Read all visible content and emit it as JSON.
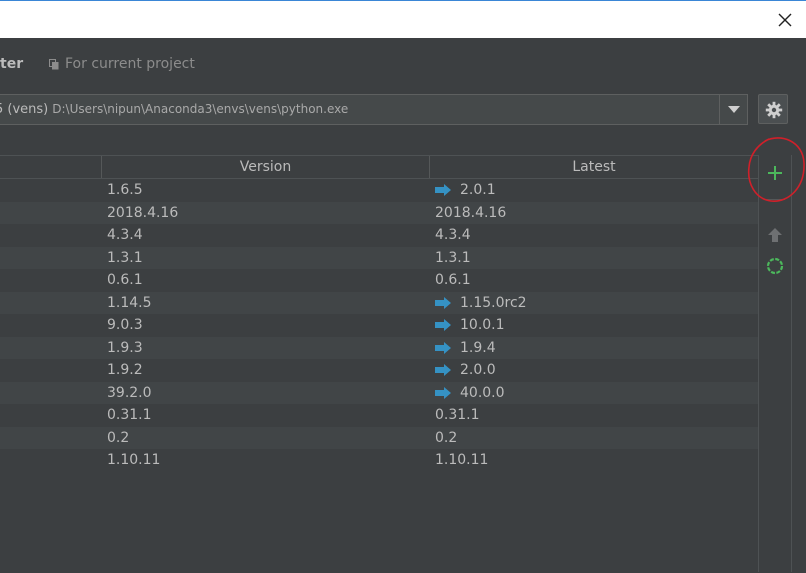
{
  "window": {
    "close_icon": "close-icon"
  },
  "breadcrumb": {
    "interpreter_partial": "ter",
    "project_label": "For current project"
  },
  "interpreter": {
    "name": "5 (vens)",
    "path": "D:\\Users\\nipun\\Anaconda3\\envs\\vens\\python.exe"
  },
  "table": {
    "columns": [
      "",
      "Version",
      "Latest"
    ],
    "rows": [
      {
        "version": "1.6.5",
        "latest": "2.0.1",
        "upgrade": true
      },
      {
        "version": "2018.4.16",
        "latest": "2018.4.16",
        "upgrade": false
      },
      {
        "version": "4.3.4",
        "latest": "4.3.4",
        "upgrade": false
      },
      {
        "version": "1.3.1",
        "latest": "1.3.1",
        "upgrade": false
      },
      {
        "version": "0.6.1",
        "latest": "0.6.1",
        "upgrade": false
      },
      {
        "version": "1.14.5",
        "latest": "1.15.0rc2",
        "upgrade": true
      },
      {
        "version": "9.0.3",
        "latest": "10.0.1",
        "upgrade": true
      },
      {
        "version": "1.9.3",
        "latest": "1.9.4",
        "upgrade": true
      },
      {
        "version": "1.9.2",
        "latest": "2.0.0",
        "upgrade": true
      },
      {
        "version": "39.2.0",
        "latest": "40.0.0",
        "upgrade": true
      },
      {
        "version": "0.31.1",
        "latest": "0.31.1",
        "upgrade": false
      },
      {
        "version": "0.2",
        "latest": "0.2",
        "upgrade": false
      },
      {
        "version": "1.10.11",
        "latest": "1.10.11",
        "upgrade": false
      }
    ]
  },
  "toolbar": {
    "add_icon": "plus-icon",
    "upgrade_icon": "arrow-up-icon",
    "loading_icon": "spinner-icon"
  },
  "colors": {
    "background": "#3c3f41",
    "add": "#4cb85c",
    "upgrade_arrow": "#3592c4",
    "annotation": "#d0202a"
  }
}
